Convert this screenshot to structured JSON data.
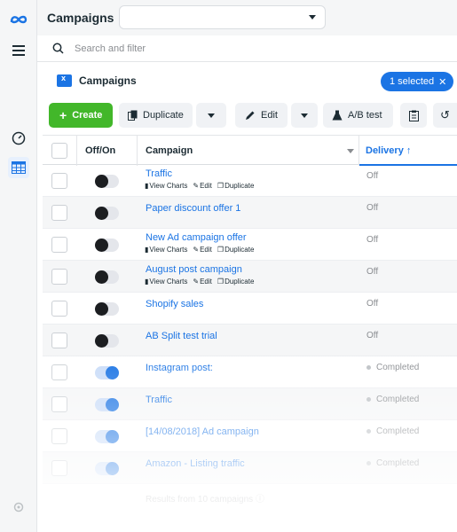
{
  "header": {
    "title": "Campaigns"
  },
  "search": {
    "placeholder": "Search and filter"
  },
  "subheader": {
    "tab_label": "Campaigns",
    "selected_pill": "1 selected"
  },
  "toolbar": {
    "create_label": "Create",
    "duplicate_label": "Duplicate",
    "edit_label": "Edit",
    "ab_test_label": "A/B test"
  },
  "table": {
    "headers": {
      "off_on": "Off/On",
      "campaign": "Campaign",
      "delivery": "Delivery"
    },
    "action_labels": {
      "view_charts": "View Charts",
      "edit": "Edit",
      "duplicate": "Duplicate"
    },
    "rows": [
      {
        "name": "Traffic",
        "on": false,
        "delivery": "Off",
        "actions": true
      },
      {
        "name": "Paper discount offer 1",
        "on": false,
        "delivery": "Off",
        "actions": false
      },
      {
        "name": "New Ad campaign offer",
        "on": false,
        "delivery": "Off",
        "actions": true
      },
      {
        "name": "August post campaign",
        "on": false,
        "delivery": "Off",
        "actions": true
      },
      {
        "name": "Shopify sales",
        "on": false,
        "delivery": "Off",
        "actions": false
      },
      {
        "name": "AB Split test trial",
        "on": false,
        "delivery": "Off",
        "actions": false
      },
      {
        "name": "Instagram post:",
        "on": true,
        "delivery": "Completed",
        "actions": false
      },
      {
        "name": "Traffic",
        "on": true,
        "delivery": "Completed",
        "actions": false
      },
      {
        "name": "[14/08/2018] Ad campaign",
        "on": true,
        "delivery": "Completed",
        "actions": false
      },
      {
        "name": "Amazon - Listing traffic",
        "on": true,
        "delivery": "Completed",
        "actions": false
      }
    ],
    "footer": "Results from 10 campaigns"
  },
  "colors": {
    "accent": "#1b74e4",
    "create": "#42b72a"
  }
}
